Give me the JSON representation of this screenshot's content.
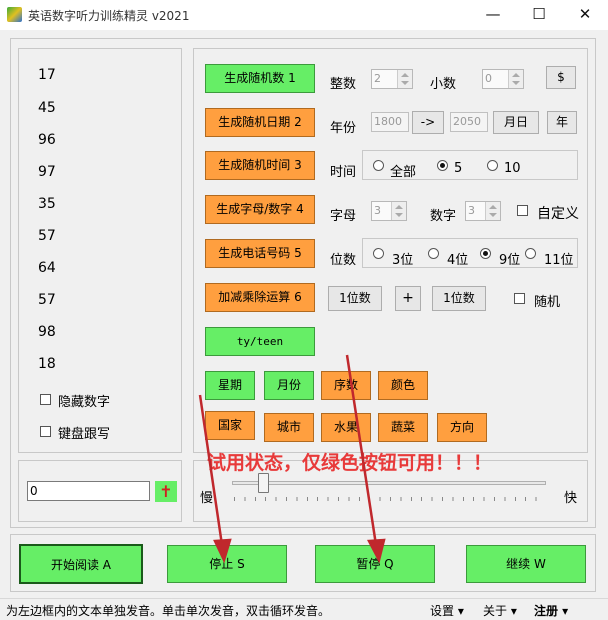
{
  "window": {
    "title": "英语数字听力训练精灵 v2021",
    "minimize": "—",
    "maximize": "☐",
    "close": "✕"
  },
  "numbers": [
    "17",
    "45",
    "96",
    "97",
    "35",
    "57",
    "64",
    "57",
    "98",
    "18"
  ],
  "hide_digits_label": "隐藏数字",
  "keyboard_follow_label": "键盘跟写",
  "input_value": "0",
  "plus_icon": "✝",
  "rows": {
    "random_number": {
      "button": "生成随机数    1",
      "int_label": "整数",
      "int_value": "2",
      "dec_label": "小数",
      "dec_value": "0",
      "currency": "$"
    },
    "random_date": {
      "button": "生成随机日期   2",
      "year_label": "年份",
      "year_from": "1800",
      "arrow": "->",
      "year_to": "2050",
      "month_day": "月日",
      "year_btn": "年"
    },
    "random_time": {
      "button": "生成随机时间   3",
      "time_label": "时间",
      "opt_all": "全部",
      "opt_5": "5",
      "opt_10": "10"
    },
    "letter_number": {
      "button": "生成字母/数字  4",
      "letter_label": "字母",
      "letter_value": "3",
      "digit_label": "数字",
      "digit_value": "3",
      "custom_label": "自定义"
    },
    "phone": {
      "button": "生成电话号码   5",
      "digits_label": "位数",
      "opt_3": "3位",
      "opt_4": "4位",
      "opt_9": "9位",
      "opt_11": "11位"
    },
    "arith": {
      "button": "加减乘除运算   6",
      "left": "1位数",
      "op": "+",
      "right": "1位数",
      "random_label": "随机"
    }
  },
  "ty_teen": "ty/teen",
  "categories_row1": [
    "星期",
    "月份",
    "序数",
    "颜色"
  ],
  "categories_row2": [
    "国家",
    "城市",
    "水果",
    "蔬菜",
    "方向"
  ],
  "trial_notice": "试用状态，仅绿色按钮可用！！！",
  "speed": {
    "slow": "慢",
    "fast": "快",
    "level": 0.1
  },
  "bottom_buttons": {
    "start": "开始阅读 A",
    "stop": "停止 S",
    "pause": "暂停 Q",
    "continue": "继续 W"
  },
  "status_bar": {
    "text": "为左边框内的文本单独发音。单击单次发音，双击循环发音。",
    "settings": "设置 ▾",
    "about": "关于 ▾",
    "register": "注册 ▾"
  },
  "colors": {
    "green": "#66ee66",
    "orange": "#ff9f3f",
    "notice": "#e83a3a",
    "arrow": "#c0282d"
  }
}
